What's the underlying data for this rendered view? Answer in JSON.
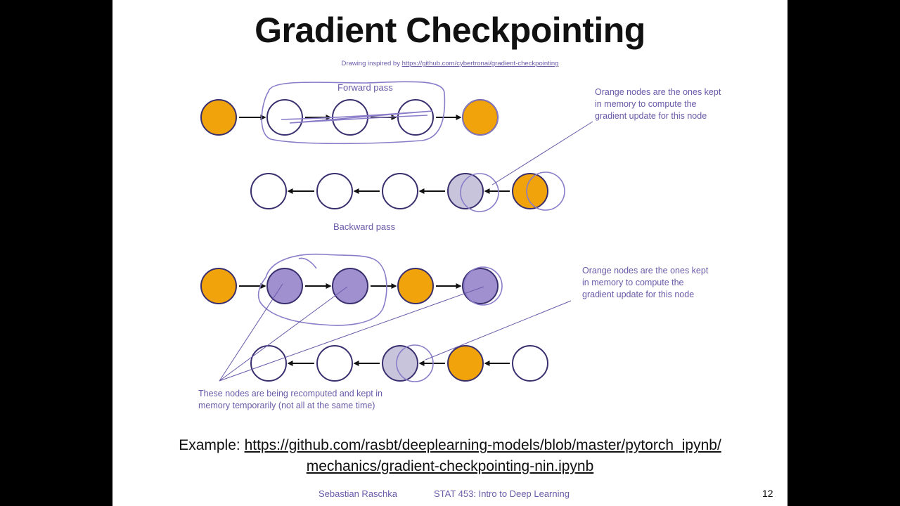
{
  "slide": {
    "title": "Gradient Checkpointing",
    "credit_prefix": "Drawing inspired by ",
    "credit_link": "https://github.com/cybertronai/gradient-checkpointing",
    "colors": {
      "orange": "#f0a30a",
      "purple": "#a090d0",
      "gray": "#c8c4dc",
      "annotation": "#6a5aa8"
    },
    "diagram_top": {
      "forward_label": "Forward pass",
      "backward_label": "Backward pass",
      "note": "Orange nodes are the ones kept in memory to compute the gradient update for this node",
      "forward_nodes": [
        "orange",
        "white",
        "white",
        "white",
        "orange"
      ],
      "backward_nodes": [
        "white",
        "white",
        "white",
        "gray",
        "orange"
      ]
    },
    "diagram_bottom": {
      "note": "Orange nodes are the ones kept in memory to compute the gradient update for this node",
      "recompute_note": "These nodes are being recomputed and kept in memory temporarily (not all at the same time)",
      "forward_nodes": [
        "orange",
        "purple",
        "purple",
        "orange",
        "purple"
      ],
      "backward_nodes": [
        "white",
        "white",
        "gray",
        "orange",
        "white"
      ]
    },
    "example_prefix": "Example: ",
    "example_link_line1": "https://github.com/rasbt/deeplearning-models/blob/master/pytorch_ipynb/",
    "example_link_line2": "mechanics/gradient-checkpointing-nin.ipynb",
    "footer_author": "Sebastian Raschka",
    "footer_course": "STAT 453: Intro to Deep Learning",
    "page_number": "12"
  }
}
